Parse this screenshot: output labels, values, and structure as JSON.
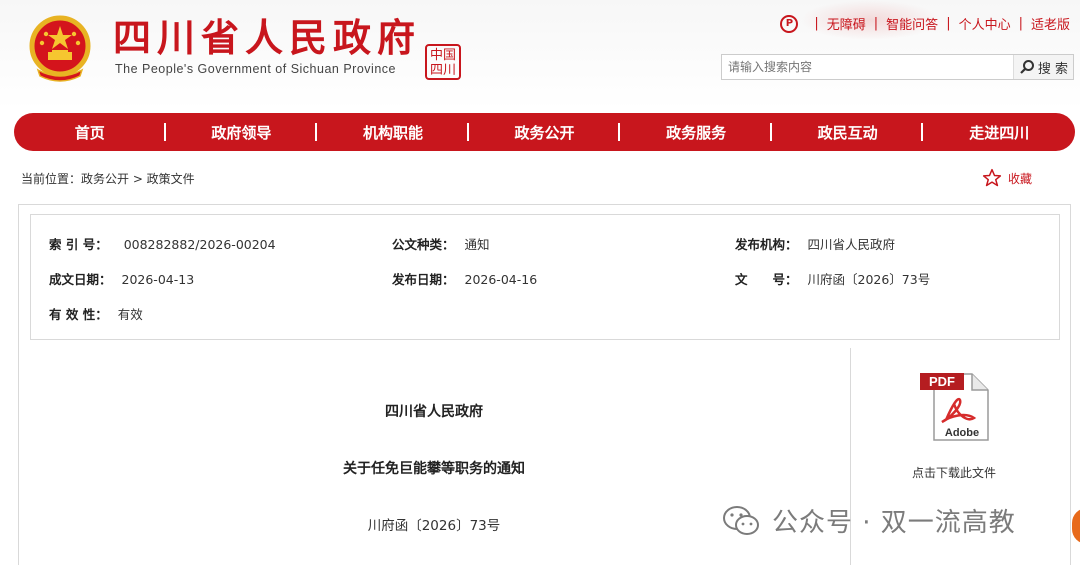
{
  "header": {
    "title": "四川省人民政府",
    "subtitle": "The People's Government of Sichuan Province",
    "seal_text": "中国\n四川",
    "top_links": [
      "无障碍",
      "智能问答",
      "个人中心",
      "适老版"
    ],
    "search_placeholder": "请输入搜索内容",
    "search_button": "搜 索"
  },
  "nav": {
    "items": [
      "首页",
      "政府领导",
      "机构职能",
      "政务公开",
      "政务服务",
      "政民互动",
      "走进四川"
    ]
  },
  "breadcrumb": "当前位置：政务公开 > 政策文件",
  "favorite_label": "收藏",
  "meta": {
    "index_label": "索 引 号：",
    "index_value": "008282882/2026-00204",
    "category_label": "公文种类：",
    "category_value": "通知",
    "publisher_label": "发布机构：",
    "publisher_value": "四川省人民政府",
    "created_label": "成文日期：",
    "created_value": "2026-04-13",
    "published_label": "发布日期：",
    "published_value": "2026-04-16",
    "doc_no_label": "文　　号：",
    "doc_no_value": "川府函〔2026〕73号",
    "validity_label": "有 效 性：",
    "validity_value": "有效"
  },
  "document": {
    "issuer": "四川省人民政府",
    "title": "关于任免巨能攀等职务的通知",
    "number": "川府函〔2026〕73号"
  },
  "download": {
    "pdf_badge": "PDF",
    "pdf_brand": "Adobe",
    "caption": "点击下载此文件"
  },
  "watermark": "公众号 · 双一流高教",
  "colors": {
    "brand_red": "#c8161d"
  }
}
